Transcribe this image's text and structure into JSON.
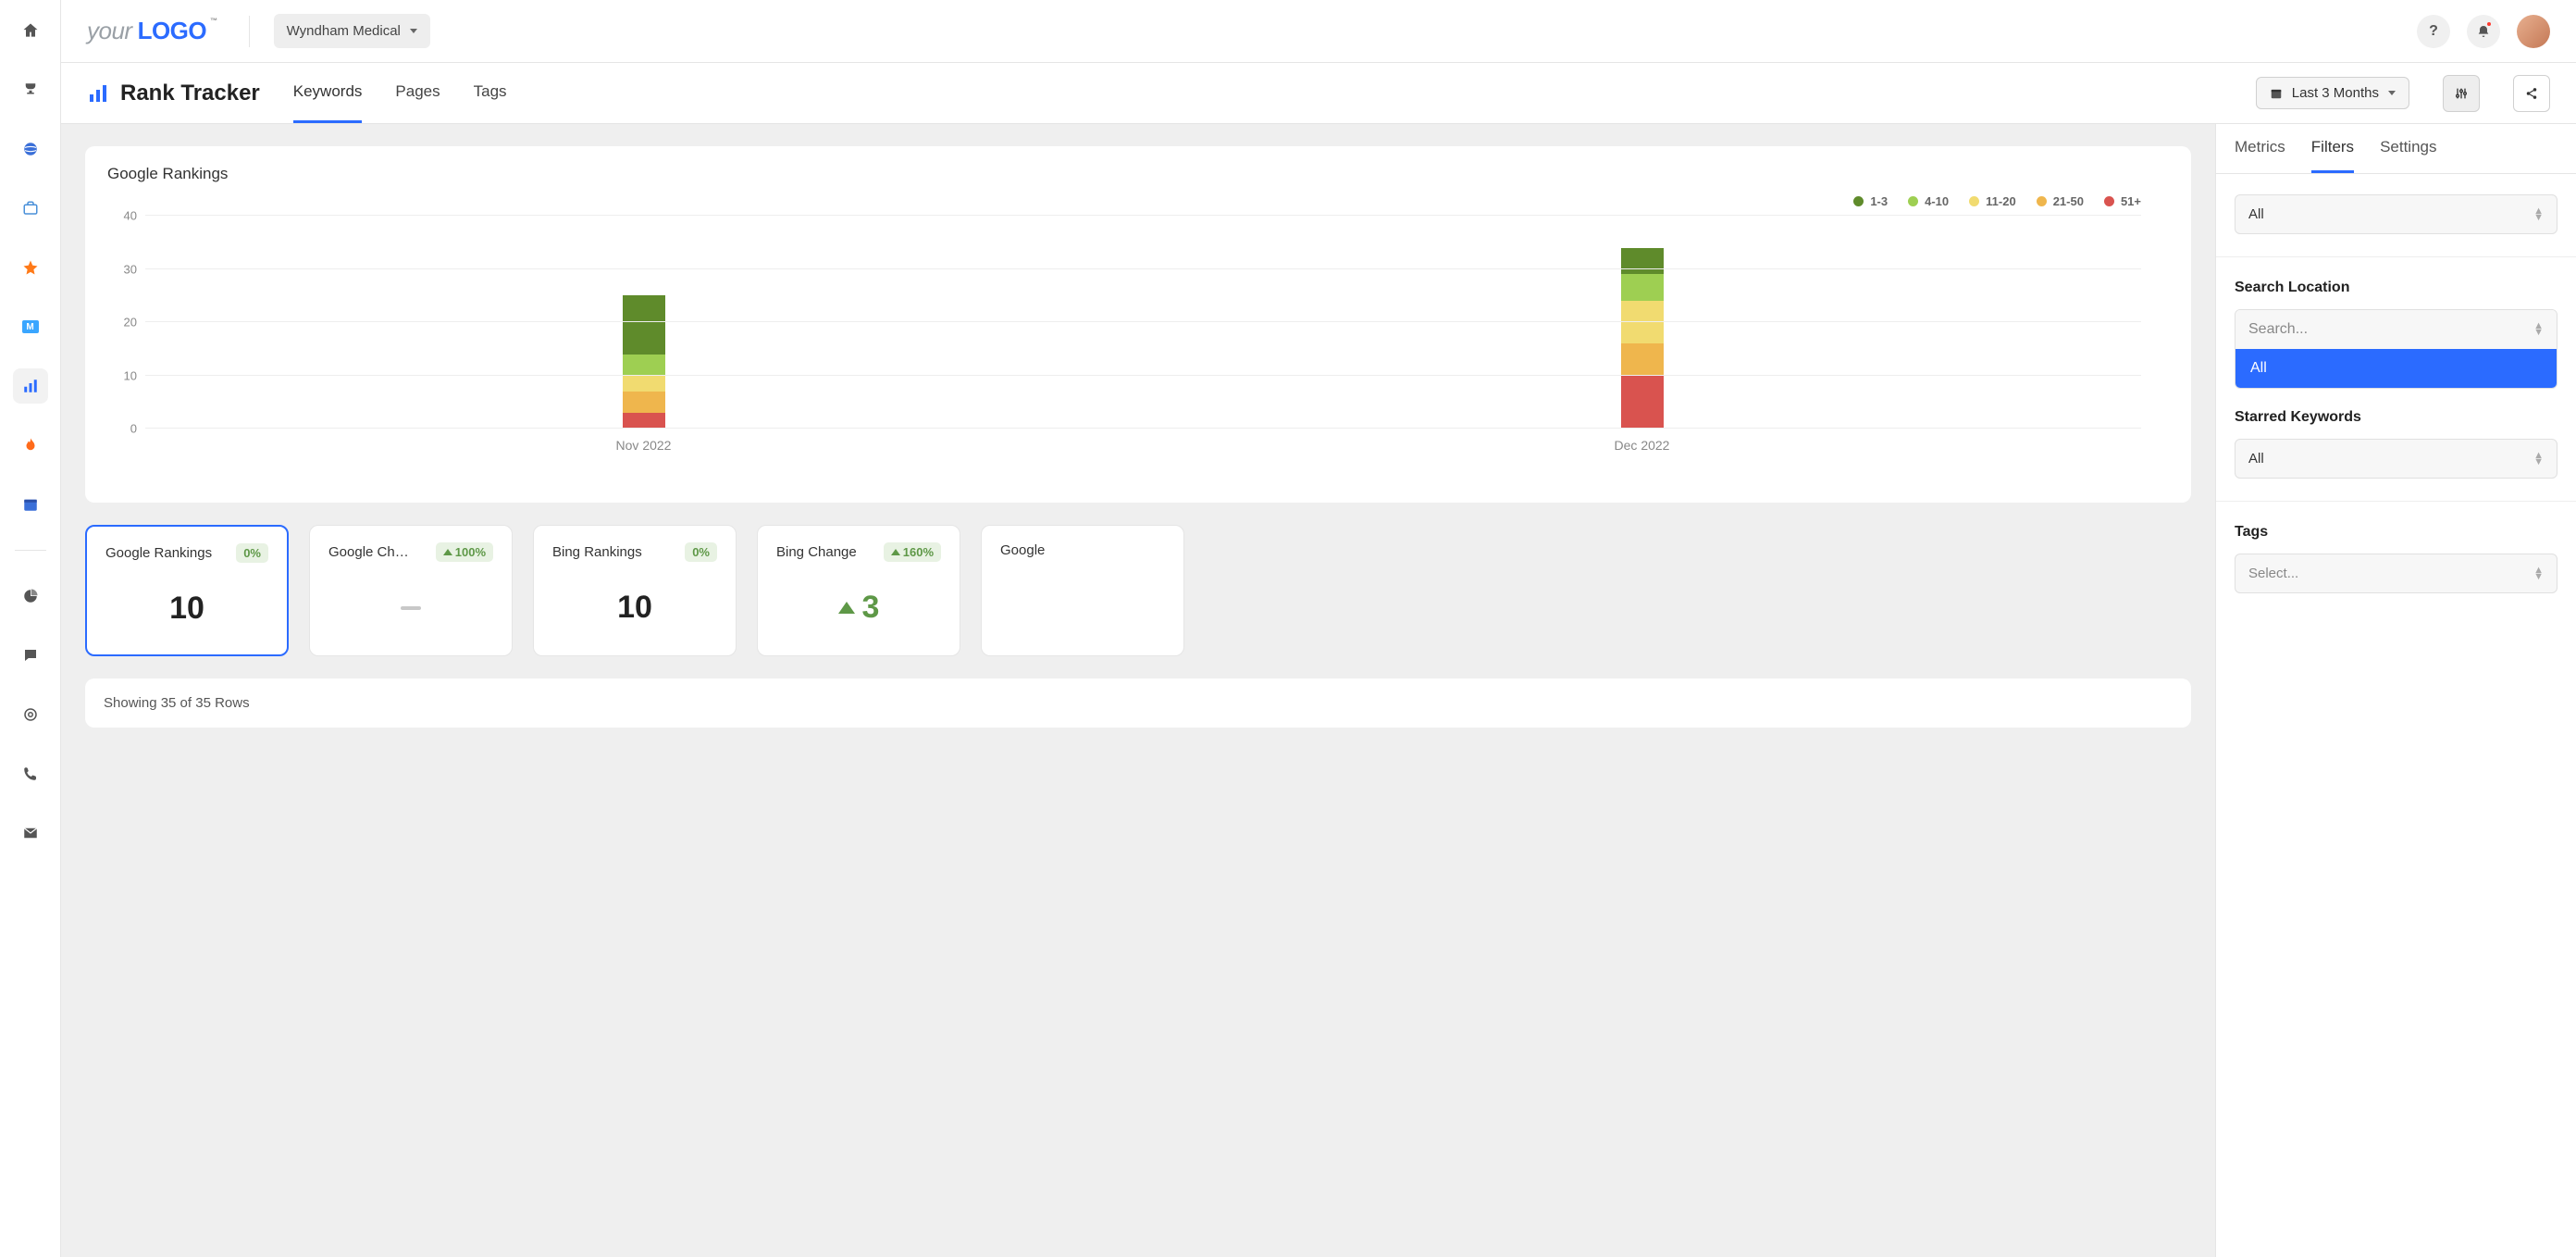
{
  "header": {
    "client": "Wyndham Medical",
    "logo_your": "your",
    "logo_logo": "LOGO",
    "logo_tm": "™"
  },
  "page": {
    "title": "Rank Tracker",
    "tabs": [
      "Keywords",
      "Pages",
      "Tags"
    ],
    "active_tab": 0,
    "date_range": "Last 3 Months"
  },
  "colors": {
    "c1_3": "#5f8b2b",
    "c4_10": "#9ecf52",
    "c11_20": "#f1db70",
    "c21_50": "#efb64d",
    "c51p": "#d9534f"
  },
  "chart_data": {
    "type": "bar",
    "title": "Google Rankings",
    "legend": [
      "1-3",
      "4-10",
      "11-20",
      "21-50",
      "51+"
    ],
    "categories": [
      "Nov 2022",
      "Dec 2022"
    ],
    "ylim": [
      0,
      40
    ],
    "yticks": [
      0,
      10,
      20,
      30,
      40
    ],
    "series": [
      {
        "name": "51+",
        "values": [
          3,
          10
        ]
      },
      {
        "name": "21-50",
        "values": [
          4,
          6
        ]
      },
      {
        "name": "11-20",
        "values": [
          3,
          8
        ]
      },
      {
        "name": "4-10",
        "values": [
          4,
          5
        ]
      },
      {
        "name": "1-3",
        "values": [
          11,
          5
        ]
      }
    ],
    "series_colors": [
      "#d9534f",
      "#efb64d",
      "#f1db70",
      "#9ecf52",
      "#5f8b2b"
    ]
  },
  "stats": [
    {
      "title": "Google Rankings",
      "badge": "0%",
      "arrow": false,
      "value": "10",
      "value_type": "number",
      "active": true
    },
    {
      "title": "Google Ch…",
      "badge": "100%",
      "arrow": true,
      "value_type": "dash"
    },
    {
      "title": "Bing Rankings",
      "badge": "0%",
      "arrow": false,
      "value": "10",
      "value_type": "number"
    },
    {
      "title": "Bing Change",
      "badge": "160%",
      "arrow": true,
      "value": "3",
      "value_type": "change"
    },
    {
      "title": "Google",
      "value_type": "cut"
    }
  ],
  "table": {
    "summary": "Showing 35 of 35 Rows"
  },
  "right_panel": {
    "tabs": [
      "Metrics",
      "Filters",
      "Settings"
    ],
    "active_tab": 1,
    "filter_all": "All",
    "search_location_label": "Search Location",
    "search_placeholder": "Search...",
    "search_dropdown_item": "All",
    "starred_label": "Starred Keywords",
    "starred_value": "All",
    "tags_label": "Tags",
    "tags_placeholder": "Select..."
  }
}
